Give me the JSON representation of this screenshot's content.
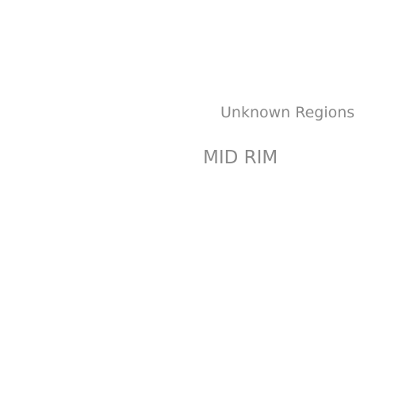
{
  "map": {
    "background_color": "#ffffff",
    "label_color": "#8a8a8a",
    "labels": {
      "unknown_regions": "Unknown Regions",
      "mid_rim": "MID RIM"
    }
  }
}
